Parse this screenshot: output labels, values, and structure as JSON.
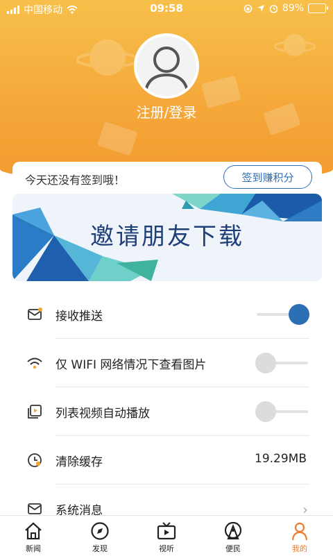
{
  "status_bar": {
    "carrier": "中国移动",
    "time": "09:58",
    "battery_percent": "89%",
    "battery_level": 0.89
  },
  "profile": {
    "login_label": "注册/登录",
    "avatar_icon": "user-avatar-icon"
  },
  "checkin": {
    "message": "今天还没有签到哦！",
    "button_label": "签到赚积分"
  },
  "banner": {
    "text": "邀请朋友下载"
  },
  "settings": [
    {
      "label": "接收推送",
      "icon": "message-icon",
      "control": "toggle",
      "on": true
    },
    {
      "label": "仅 WIFI 网络情况下查看图片",
      "icon": "wifi-icon",
      "control": "toggle",
      "on": false
    },
    {
      "label": "列表视频自动播放",
      "icon": "video-icon",
      "control": "toggle",
      "on": false
    },
    {
      "label": "清除缓存",
      "icon": "clock-icon",
      "control": "value",
      "value": "19.29MB"
    },
    {
      "label": "系统消息",
      "icon": "mail-icon",
      "control": "chevron"
    }
  ],
  "tabs": [
    {
      "label": "新闻",
      "icon": "home-icon",
      "active": false
    },
    {
      "label": "发现",
      "icon": "compass-icon",
      "active": false
    },
    {
      "label": "视听",
      "icon": "tv-icon",
      "active": false
    },
    {
      "label": "便民",
      "icon": "broadcast-icon",
      "active": false
    },
    {
      "label": "我的",
      "icon": "person-icon",
      "active": true
    }
  ],
  "colors": {
    "header_orange": "#f5a93a",
    "accent_blue": "#2d6fb5",
    "active_tab": "#ef7b2d"
  }
}
